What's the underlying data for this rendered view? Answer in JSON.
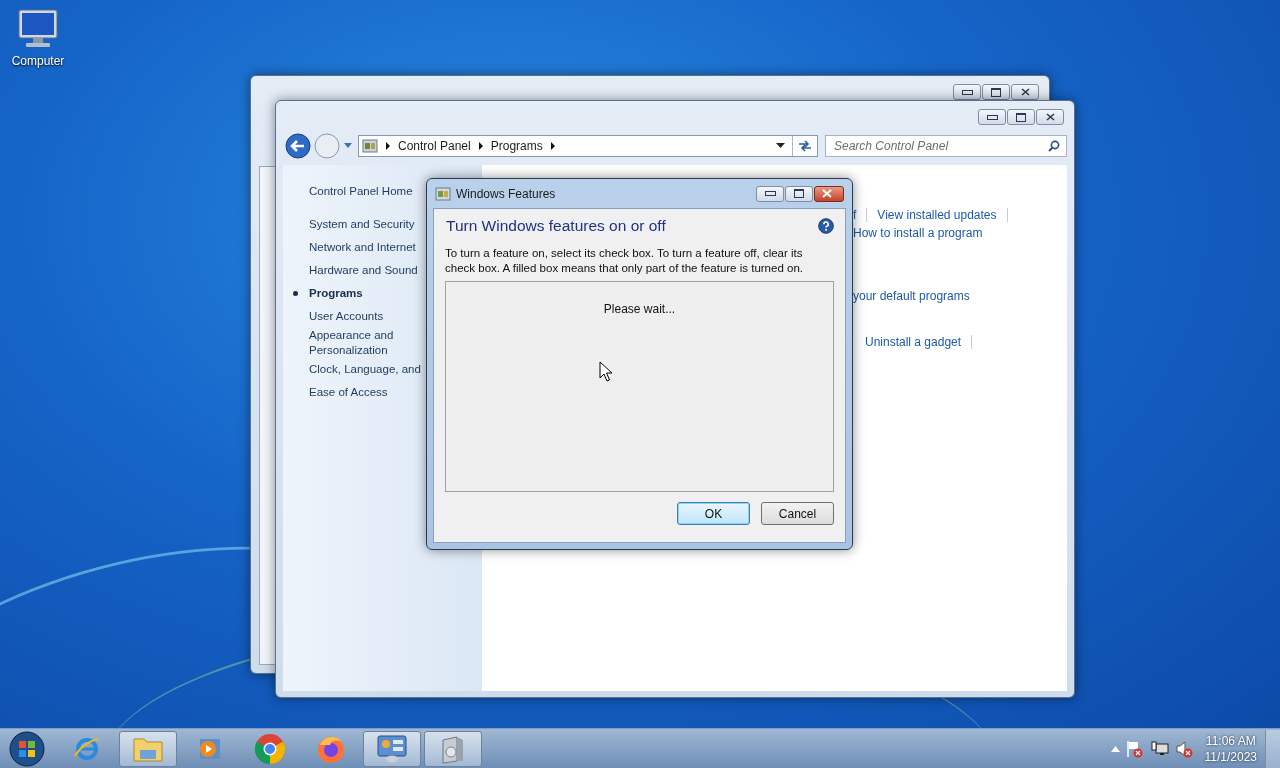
{
  "desktop_icons": [
    {
      "label": "Computer"
    }
  ],
  "control_panel": {
    "breadcrumb": [
      "Control Panel",
      "Programs"
    ],
    "search": {
      "placeholder": "Search Control Panel"
    },
    "nav": [
      {
        "kind": "home",
        "label": "Control Panel Home",
        "selected": false
      },
      {
        "kind": "category",
        "label": "System and Security",
        "selected": false
      },
      {
        "kind": "category",
        "label": "Network and Internet",
        "selected": false
      },
      {
        "kind": "category",
        "label": "Hardware and Sound",
        "selected": false
      },
      {
        "kind": "category",
        "label": "Programs",
        "selected": true
      },
      {
        "kind": "category",
        "label": "User Accounts",
        "selected": false
      },
      {
        "kind": "category",
        "label": "Appearance and Personalization",
        "selected": false
      },
      {
        "kind": "category",
        "label": "Clock, Language, and",
        "selected": false
      },
      {
        "kind": "category",
        "label": "Ease of Access",
        "selected": false
      }
    ],
    "link_rows": [
      {
        "links": [
          "f",
          "View installed updates"
        ],
        "separators": true
      },
      {
        "links": [
          "How to install a program"
        ],
        "separators": false
      },
      {
        "links": [
          "your default programs"
        ],
        "separators": false
      },
      {
        "links": [
          "Uninstall a gadget"
        ],
        "separators": true
      }
    ]
  },
  "dialog": {
    "title": "Windows Features",
    "heading": "Turn Windows features on or off",
    "description": "To turn a feature on, select its check box. To turn a feature off, clear its check box. A filled box means that only part of the feature is turned on.",
    "status": "Please wait...",
    "buttons": [
      {
        "label": "OK",
        "default": true
      },
      {
        "label": "Cancel",
        "default": false
      }
    ]
  },
  "taskbar": {
    "apps": [
      {
        "kind": "ie",
        "active": false
      },
      {
        "kind": "explorer",
        "active": true
      },
      {
        "kind": "media",
        "active": false
      },
      {
        "kind": "chrome",
        "active": false
      },
      {
        "kind": "firefox",
        "active": false
      },
      {
        "kind": "control-panel",
        "active": true
      },
      {
        "kind": "programs",
        "active": true
      }
    ],
    "clock": {
      "time": "11:06 AM",
      "date": "11/1/2023"
    }
  }
}
